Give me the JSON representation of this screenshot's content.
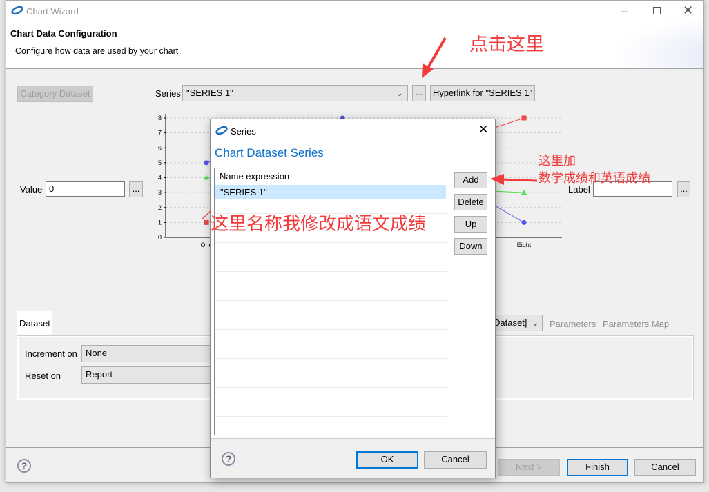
{
  "window": {
    "title": "Chart Wizard",
    "icon": "birt-logo-icon"
  },
  "header": {
    "title": "Chart Data Configuration",
    "subtitle": "Configure how data are used by your chart"
  },
  "main": {
    "category_dataset_button": "Category Dataset",
    "series_label": "Series",
    "series_value": "\"SERIES 1\"",
    "ellipsis": "...",
    "hyperlink_button": "Hyperlink for \"SERIES 1\"",
    "value_label": "Value",
    "value_input": "0",
    "label_label": "Label",
    "label_input": ""
  },
  "chart_data": {
    "type": "line",
    "y_ticks": [
      "0",
      "1",
      "2",
      "3",
      "4",
      "5",
      "6",
      "7",
      "8"
    ],
    "ylim": [
      0,
      8
    ],
    "x_tick_labels": [
      "One",
      "Eight"
    ],
    "grid": true,
    "series": [
      {
        "color": "#5555ee",
        "marker": "circle",
        "points": [
          [
            1,
            5
          ],
          [
            4,
            8
          ],
          [
            8,
            1
          ]
        ]
      },
      {
        "color": "#55dd55",
        "marker": "triangle",
        "points": [
          [
            1,
            4
          ],
          [
            8,
            3
          ]
        ]
      },
      {
        "color": "#f04848",
        "marker": "square",
        "points": [
          [
            1,
            1
          ],
          [
            8,
            8
          ]
        ]
      }
    ]
  },
  "dataset_tab": {
    "tab": "Dataset",
    "increment_label": "Increment on",
    "increment_value": "None",
    "reset_label": "Reset on",
    "reset_value": "Report",
    "right_combo": "Dataset]",
    "parameters": "Parameters",
    "parameters_map": "Parameters Map"
  },
  "footer": {
    "next": "Next >",
    "finish": "Finish",
    "cancel": "Cancel"
  },
  "dialog": {
    "title": "Series",
    "heading": "Chart Dataset Series",
    "column_header": "Name expression",
    "rows": [
      "\"SERIES 1\""
    ],
    "add": "Add",
    "delete": "Delete",
    "up": "Up",
    "down": "Down",
    "ok": "OK",
    "cancel": "Cancel"
  },
  "annotations": {
    "click_here": "点击这里",
    "add_here_1": "这里加",
    "add_here_2": "数学成绩和英语成绩",
    "rename": "这里名称我修改成语文成绩"
  },
  "colors": {
    "accent": "#0078d7",
    "heading": "#0a70c8",
    "annotation": "#f03c3c",
    "selection": "#cce8ff"
  }
}
